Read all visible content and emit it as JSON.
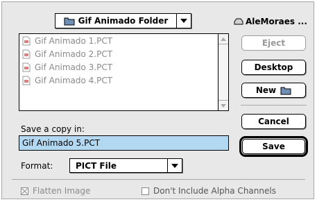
{
  "folder_popup": {
    "label": "Gif Animado Folder"
  },
  "volume": {
    "label": "AleMoraes ..."
  },
  "files": [
    "Gif Animado 1.PCT",
    "Gif Animado 2.PCT",
    "Gif Animado 3.PCT",
    "Gif Animado 4.PCT"
  ],
  "buttons": {
    "eject": "Eject",
    "desktop": "Desktop",
    "new": "New",
    "cancel": "Cancel",
    "save": "Save"
  },
  "save_label": "Save a copy in:",
  "filename_value": "Gif Animado 5.PCT",
  "format": {
    "label": "Format:",
    "value": "PICT File"
  },
  "options": {
    "flatten": {
      "label": "Flatten Image",
      "checked": true
    },
    "alpha": {
      "label": "Don't Include Alpha Channels",
      "checked": false
    }
  },
  "colors": {
    "selection": "#b3d9f2",
    "dialog_bg": "#e8e8e8"
  }
}
